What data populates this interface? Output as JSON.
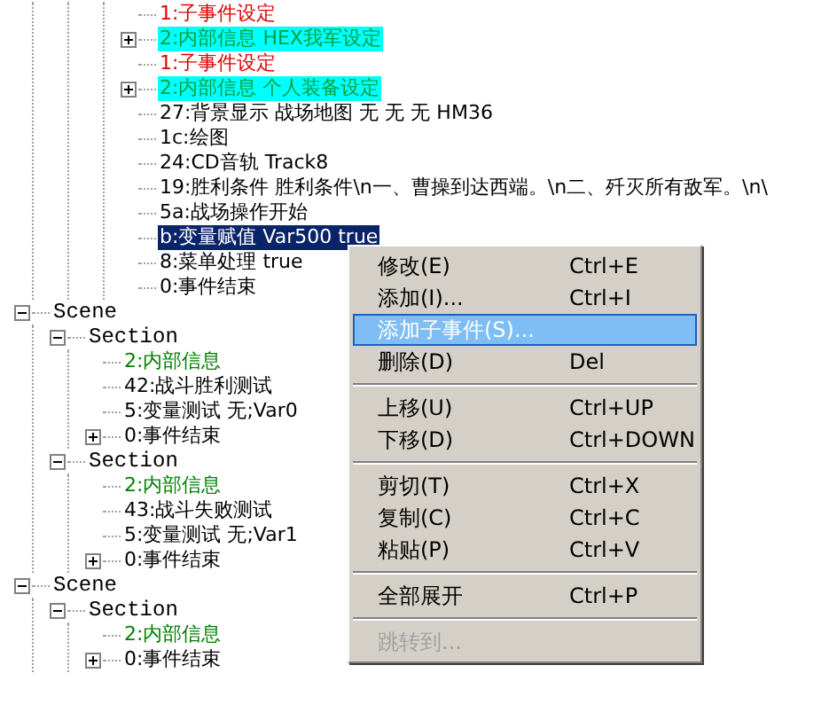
{
  "tree": [
    {
      "children": [
        {
          "children": [
            {
              "children": [
                {
                  "label": "1:子事件设定",
                  "kind": "sub",
                  "selected": false
                },
                {
                  "label": "2:内部信息 HEX我军设定",
                  "kind": "info-marked",
                  "selected": false,
                  "expanded": false
                },
                {
                  "label": "1:子事件设定",
                  "kind": "sub",
                  "selected": false
                },
                {
                  "label": "2:内部信息 个人装备设定",
                  "kind": "info-marked",
                  "selected": false,
                  "expanded": false
                },
                {
                  "label": "27:背景显示 战场地图 无 无 无 HM36",
                  "kind": "command",
                  "selected": false
                },
                {
                  "label": "1c:绘图",
                  "kind": "command",
                  "selected": false
                },
                {
                  "label": "24:CD音轨 Track8",
                  "kind": "command",
                  "selected": false
                },
                {
                  "label": "19:胜利条件 胜利条件\\n一、曹操到达西端。\\n二、歼灭所有敌军。\\n\\",
                  "kind": "command",
                  "selected": false
                },
                {
                  "label": "5a:战场操作开始",
                  "kind": "command",
                  "selected": false
                },
                {
                  "label": "b:变量赋值 Var500 true",
                  "kind": "command",
                  "selected": true
                },
                {
                  "label": "8:菜单处理 true",
                  "kind": "command",
                  "selected": false
                },
                {
                  "label": "0:事件结束",
                  "kind": "command",
                  "selected": false
                }
              ]
            }
          ]
        }
      ]
    },
    {
      "label": "Scene",
      "kind": "group",
      "selected": false,
      "expanded": true,
      "children": [
        {
          "label": "Section",
          "kind": "group",
          "selected": false,
          "expanded": true,
          "children": [
            {
              "label": "2:内部信息",
              "kind": "info",
              "selected": false
            },
            {
              "label": "42:战斗胜利测试",
              "kind": "command",
              "selected": false
            },
            {
              "label": "5:变量测试 无;Var0",
              "kind": "command",
              "selected": false
            },
            {
              "label": "0:事件结束",
              "kind": "command",
              "selected": false,
              "expanded": false
            }
          ]
        },
        {
          "label": "Section",
          "kind": "group",
          "selected": false,
          "expanded": true,
          "children": [
            {
              "label": "2:内部信息",
              "kind": "info",
              "selected": false
            },
            {
              "label": "43:战斗失败测试",
              "kind": "command",
              "selected": false
            },
            {
              "label": "5:变量测试 无;Var1",
              "kind": "command",
              "selected": false
            },
            {
              "label": "0:事件结束",
              "kind": "command",
              "selected": false,
              "expanded": false
            }
          ]
        }
      ]
    },
    {
      "label": "Scene",
      "kind": "group",
      "selected": false,
      "expanded": true,
      "children": [
        {
          "label": "Section",
          "kind": "group",
          "selected": false,
          "expanded": true,
          "children": [
            {
              "label": "2:内部信息",
              "kind": "info",
              "selected": false
            },
            {
              "label": "0:事件结束",
              "kind": "command",
              "selected": false,
              "expanded": false
            }
          ]
        }
      ]
    }
  ],
  "context_menu": [
    {
      "kind": "item",
      "label": "修改(E)",
      "shortcut": "Ctrl+E",
      "selected": false,
      "disabled": false
    },
    {
      "kind": "item",
      "label": "添加(I)...",
      "shortcut": "Ctrl+I",
      "selected": false,
      "disabled": false
    },
    {
      "kind": "item",
      "label": "添加子事件(S)...",
      "selected": true,
      "disabled": false
    },
    {
      "kind": "item",
      "label": "删除(D)",
      "shortcut": "Del",
      "selected": false,
      "disabled": false
    },
    {
      "kind": "separator"
    },
    {
      "kind": "item",
      "label": "上移(U)",
      "shortcut": "Ctrl+UP",
      "selected": false,
      "disabled": false
    },
    {
      "kind": "item",
      "label": "下移(D)",
      "shortcut": "Ctrl+DOWN",
      "selected": false,
      "disabled": false
    },
    {
      "kind": "separator"
    },
    {
      "kind": "item",
      "label": "剪切(T)",
      "shortcut": "Ctrl+X",
      "selected": false,
      "disabled": false
    },
    {
      "kind": "item",
      "label": "复制(C)",
      "shortcut": "Ctrl+C",
      "selected": false,
      "disabled": false
    },
    {
      "kind": "item",
      "label": "粘贴(P)",
      "shortcut": "Ctrl+V",
      "selected": false,
      "disabled": false
    },
    {
      "kind": "separator"
    },
    {
      "kind": "item",
      "label": "全部展开",
      "shortcut": "Ctrl+P",
      "selected": false,
      "disabled": false
    },
    {
      "kind": "separator"
    },
    {
      "kind": "item",
      "label": "跳转到...",
      "selected": false,
      "disabled": true
    }
  ]
}
